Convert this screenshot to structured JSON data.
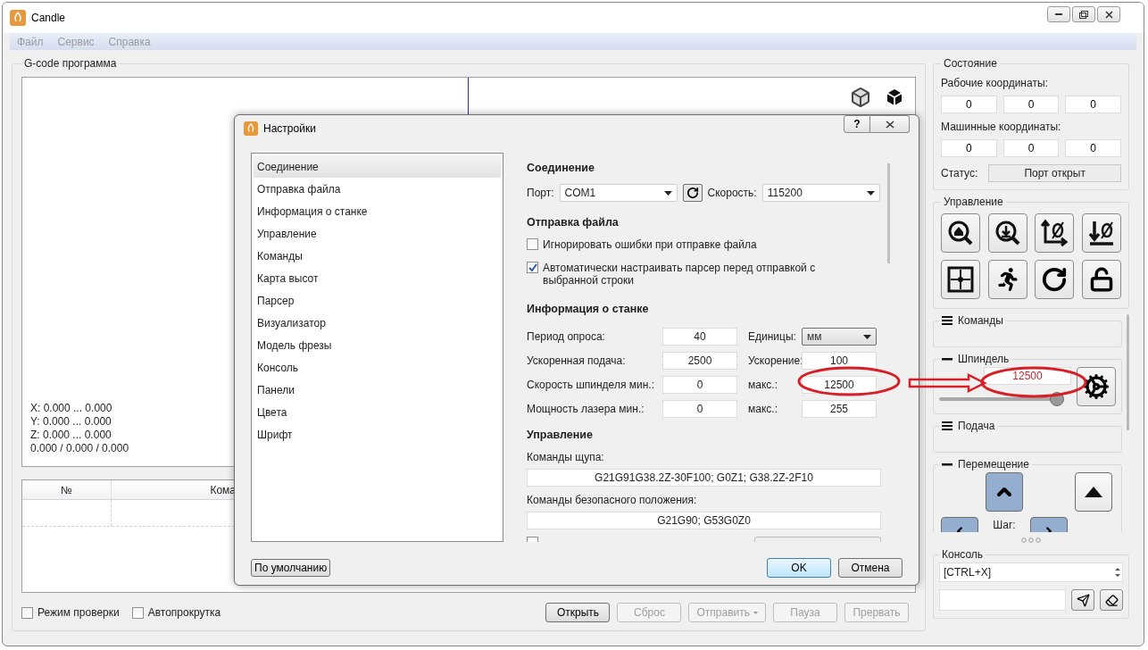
{
  "window": {
    "title": "Candle"
  },
  "menu": [
    {
      "label": "Файл",
      "disabled": true
    },
    {
      "label": "Сервис",
      "disabled": true
    },
    {
      "label": "Справка",
      "disabled": true
    }
  ],
  "program": {
    "title": "G-code программа",
    "readout": [
      "X: 0.000 ... 0.000",
      "Y: 0.000 ... 0.000",
      "Z: 0.000 ... 0.000",
      "0.000 / 0.000 / 0.000"
    ],
    "table": {
      "columns": [
        "№",
        "Кома"
      ]
    },
    "checkboxes": [
      {
        "label": "Режим проверки",
        "checked": false
      },
      {
        "label": "Автопрокрутка",
        "checked": false
      }
    ],
    "buttons": [
      {
        "label": "Открыть",
        "disabled": false,
        "menu": false
      },
      {
        "label": "Сброс",
        "disabled": true,
        "menu": false
      },
      {
        "label": "Отправить",
        "disabled": true,
        "menu": true
      },
      {
        "label": "Пауза",
        "disabled": true,
        "menu": false
      },
      {
        "label": "Прервать",
        "disabled": true,
        "menu": false
      }
    ]
  },
  "state": {
    "title": "Состояние",
    "work_label": "Рабочие координаты:",
    "work": [
      "0",
      "0",
      "0"
    ],
    "machine_label": "Машинные координаты:",
    "machine": [
      "0",
      "0",
      "0"
    ],
    "status_label": "Статус:",
    "status": "Порт открыт"
  },
  "control": {
    "title": "Управление"
  },
  "commands": {
    "title": "Команды",
    "expanded": false
  },
  "spindle": {
    "title": "Шпиндель",
    "expanded": true,
    "speed": "12500",
    "level": 1
  },
  "feed": {
    "title": "Подача",
    "expanded": false
  },
  "jog": {
    "title": "Перемещение",
    "expanded": true,
    "step_label": "Шаг:"
  },
  "console": {
    "title": "Консоль",
    "history": "[CTRL+X]"
  },
  "dialog": {
    "title": "Настройки",
    "help": "?",
    "nav": [
      {
        "label": "Соединение",
        "selected": true
      },
      {
        "label": "Отправка файла",
        "selected": false
      },
      {
        "label": "Информация о станке",
        "selected": false
      },
      {
        "label": "Управление",
        "selected": false
      },
      {
        "label": "Команды",
        "selected": false
      },
      {
        "label": "Карта высот",
        "selected": false
      },
      {
        "label": "Парсер",
        "selected": false
      },
      {
        "label": "Визуализатор",
        "selected": false
      },
      {
        "label": "Модель фрезы",
        "selected": false
      },
      {
        "label": "Консоль",
        "selected": false
      },
      {
        "label": "Панели",
        "selected": false
      },
      {
        "label": "Цвета",
        "selected": false
      },
      {
        "label": "Шрифт",
        "selected": false
      }
    ],
    "connection": {
      "heading": "Соединение",
      "port_label": "Порт:",
      "port": "COM1",
      "speed_label": "Скорость:",
      "speed": "115200"
    },
    "sending": {
      "heading": "Отправка файла",
      "options": [
        {
          "label": "Игнорировать ошибки при отправке файла",
          "checked": false
        },
        {
          "label": "Автоматически настраивать парсер перед отправкой с выбранной строки",
          "checked": true
        }
      ]
    },
    "machine": {
      "heading": "Информация о станке",
      "rows": [
        {
          "label": "Период опроса:",
          "value": "40",
          "right_label": "Единицы:",
          "right_value": "мм",
          "kind": "select"
        },
        {
          "label": "Ускоренная подача:",
          "value": "2500",
          "right_label": "Ускорение:",
          "right_value": "100",
          "kind": "field"
        },
        {
          "label": "Скорость шпинделя мин.:",
          "value": "0",
          "right_label": "макс.:",
          "right_value": "12500",
          "kind": "field"
        },
        {
          "label": "Мощность лазера мин.:",
          "value": "0",
          "right_label": "макс.:",
          "right_value": "255",
          "kind": "field"
        }
      ]
    },
    "control": {
      "heading": "Управление",
      "probe_label": "Команды щупа:",
      "probe": "G21G91G38.2Z-30F100; G0Z1; G38.2Z-2F10",
      "safe_label": "Команды безопасного положения:",
      "safe": "G21G90; G53G0Z0",
      "cut_option": {
        "checked": false
      }
    },
    "defaults_button": "По умолчанию",
    "ok": "OK",
    "cancel": "Отмена"
  }
}
